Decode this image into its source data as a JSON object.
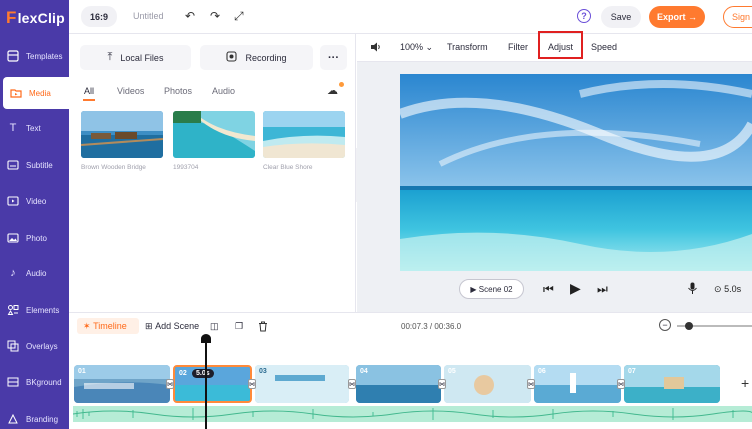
{
  "app": {
    "logo_text": "lexClip",
    "logo_f": "F"
  },
  "sidebar": {
    "items": [
      {
        "label": "Templates",
        "icon": "templates-icon"
      },
      {
        "label": "Media",
        "icon": "media-folder-icon"
      },
      {
        "label": "Text",
        "icon": "text-icon"
      },
      {
        "label": "Subtitle",
        "icon": "subtitle-icon"
      },
      {
        "label": "Video",
        "icon": "video-icon"
      },
      {
        "label": "Photo",
        "icon": "photo-icon"
      },
      {
        "label": "Audio",
        "icon": "audio-icon"
      },
      {
        "label": "Elements",
        "icon": "elements-icon"
      },
      {
        "label": "Overlays",
        "icon": "overlays-icon"
      },
      {
        "label": "BKground",
        "icon": "background-icon"
      },
      {
        "label": "Branding",
        "icon": "branding-icon"
      }
    ],
    "active": "Media"
  },
  "topbar": {
    "ratio": "16:9",
    "project_title": "Untitled",
    "save_label": "Save",
    "export_label": "Export →",
    "signin_label": "Sign"
  },
  "media": {
    "local_files_label": "Local Files",
    "recording_label": "Recording",
    "more_label": "···",
    "tabs": [
      "All",
      "Videos",
      "Photos",
      "Audio"
    ],
    "active_tab": "All",
    "items": [
      {
        "caption": "Brown Wooden Bridge"
      },
      {
        "caption": "1993704"
      },
      {
        "caption": "Clear Blue Shore"
      }
    ]
  },
  "editbar": {
    "zoom": "100%",
    "transform_label": "Transform",
    "filter_label": "Filter",
    "adjust_label": "Adjust",
    "speed_label": "Speed"
  },
  "player": {
    "scene_label": "Scene",
    "scene_number": "02",
    "duration": "5.0s"
  },
  "timeline": {
    "timeline_label": "Timeline",
    "add_scene_label": "Add Scene",
    "current_time": "00:07.3",
    "total_time": "00:36.0",
    "time_separator": " / ",
    "zoom_level": 0.1,
    "selected_duration": "5.0s",
    "clips": [
      {
        "num": "01",
        "color": "#6fa4c8"
      },
      {
        "num": "02",
        "color": "#2e88c8"
      },
      {
        "num": "03",
        "color": "#8ec7e6"
      },
      {
        "num": "04",
        "color": "#4a90b8"
      },
      {
        "num": "05",
        "color": "#a9d3e8"
      },
      {
        "num": "06",
        "color": "#7bbce0"
      },
      {
        "num": "07",
        "color": "#2f8fb5"
      }
    ]
  }
}
